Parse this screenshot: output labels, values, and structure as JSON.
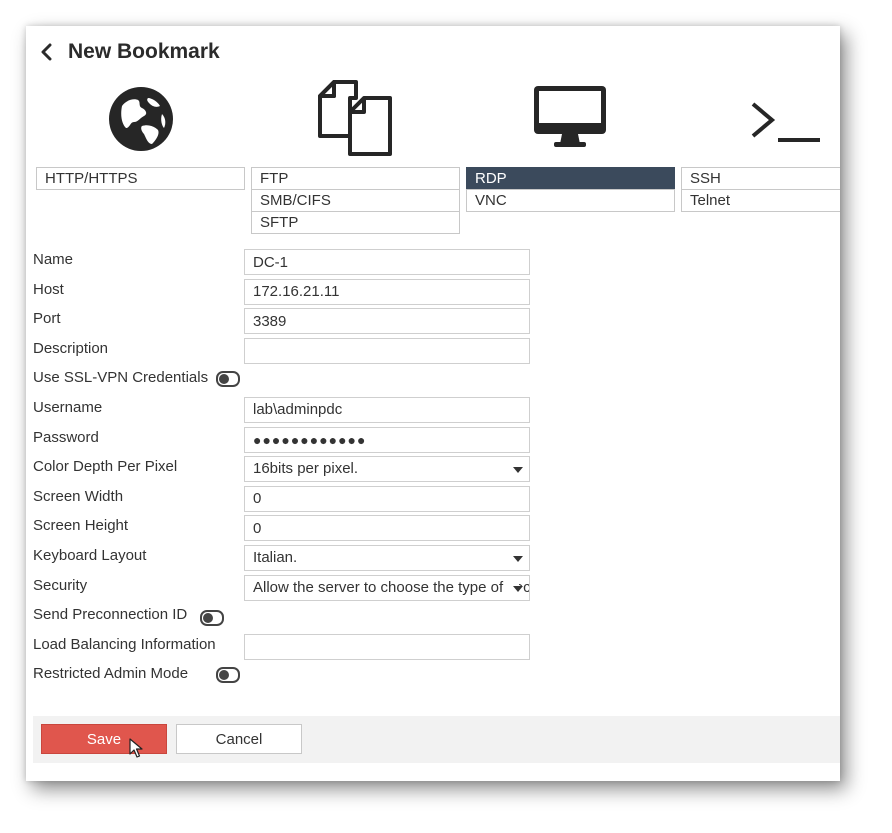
{
  "header": {
    "title": "New Bookmark"
  },
  "types": {
    "col1": [
      "HTTP/HTTPS"
    ],
    "col2": [
      "FTP",
      "SMB/CIFS",
      "SFTP"
    ],
    "col3": [
      "RDP",
      "VNC"
    ],
    "col4": [
      "SSH",
      "Telnet"
    ],
    "selected": "RDP",
    "icons": [
      "globe-icon",
      "copy-documents-icon",
      "monitor-icon",
      "terminal-icon"
    ]
  },
  "form": {
    "name": {
      "label": "Name",
      "value": "DC-1"
    },
    "host": {
      "label": "Host",
      "value": "172.16.21.11"
    },
    "port": {
      "label": "Port",
      "value": "3389"
    },
    "description": {
      "label": "Description",
      "value": ""
    },
    "use_ssl_vpn": {
      "label": "Use SSL-VPN Credentials",
      "enabled": false
    },
    "username": {
      "label": "Username",
      "value": "lab\\adminpdc"
    },
    "password": {
      "label": "Password",
      "value": "●●●●●●●●●●●●"
    },
    "color_depth": {
      "label": "Color Depth Per Pixel",
      "value": "16bits per pixel."
    },
    "screen_width": {
      "label": "Screen Width",
      "value": "0"
    },
    "screen_height": {
      "label": "Screen Height",
      "value": "0"
    },
    "keyboard_layout": {
      "label": "Keyboard Layout",
      "value": "Italian."
    },
    "security": {
      "label": "Security",
      "value": "Allow the server to choose the type of security"
    },
    "send_preconnection_id": {
      "label": "Send Preconnection ID",
      "enabled": false
    },
    "load_balancing": {
      "label": "Load Balancing Information",
      "value": ""
    },
    "restricted_admin": {
      "label": "Restricted Admin Mode",
      "enabled": false
    }
  },
  "footer": {
    "save_label": "Save",
    "cancel_label": "Cancel"
  },
  "colors": {
    "save": "#e0564d",
    "selected": "#3b4a5c"
  }
}
